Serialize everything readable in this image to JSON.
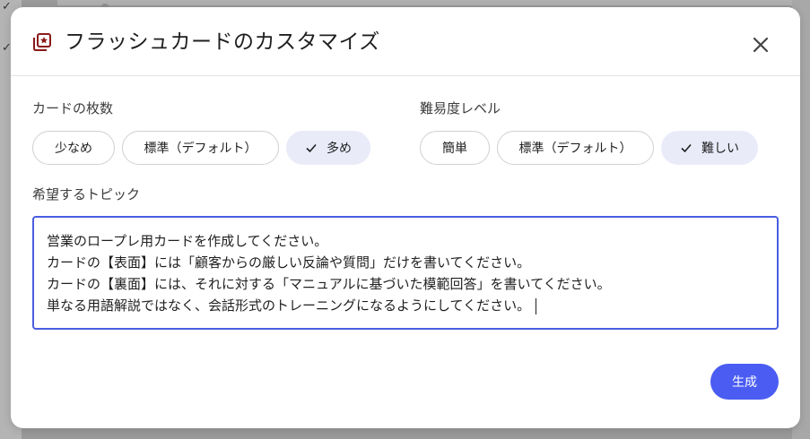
{
  "dialog": {
    "title": "フラッシュカードのカスタマイズ",
    "close_icon": "close-icon",
    "title_icon": "flashcard-star-icon",
    "accent_color": "#4a5cf2",
    "title_icon_color": "#8b1a1a"
  },
  "card_count": {
    "label": "カードの枚数",
    "options": [
      {
        "label": "少なめ",
        "selected": false
      },
      {
        "label": "標準（デフォルト）",
        "selected": false
      },
      {
        "label": "多め",
        "selected": true
      }
    ]
  },
  "difficulty": {
    "label": "難易度レベル",
    "options": [
      {
        "label": "簡単",
        "selected": false
      },
      {
        "label": "標準（デフォルト）",
        "selected": false
      },
      {
        "label": "難しい",
        "selected": true
      }
    ]
  },
  "topic": {
    "label": "希望するトピック",
    "lines": [
      "営業のロープレ用カードを作成してください。",
      "カードの【表面】には「顧客からの厳しい反論や質問」だけを書いてください。",
      "カードの【裏面】には、それに対する「マニュアルに基づいた模範回答」を書いてください。",
      "単なる用語解説ではなく、会話形式のトレーニングになるようにしてください。"
    ]
  },
  "actions": {
    "generate_label": "生成"
  }
}
